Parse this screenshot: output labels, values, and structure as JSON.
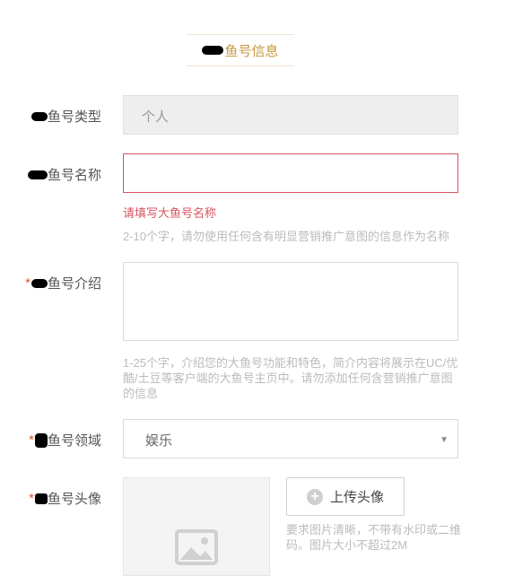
{
  "section": {
    "title": "鱼号信息"
  },
  "form": {
    "type": {
      "label": "鱼号类型",
      "value": "个人"
    },
    "name": {
      "label": "鱼号名称",
      "value": "",
      "error": "请填写大鱼号名称",
      "hint": "2-10个字，请勿使用任何含有明显营销推广意图的信息作为名称"
    },
    "intro": {
      "label": "鱼号介绍",
      "required_mark": "*",
      "value": "",
      "hint": "1-25个字，介绍您的大鱼号功能和特色，简介内容将展示在UC/优酷/土豆等客户端的大鱼号主页中。请勿添加任何含营销推广意图的信息"
    },
    "domain": {
      "label": "鱼号领域",
      "required_mark": "*",
      "value": "娱乐",
      "arrow_icon": "caret-down-icon"
    },
    "avatar": {
      "label": "鱼号头像",
      "required_mark": "*",
      "upload_label": "上传头像",
      "upload_icon": "plus-circle-icon",
      "placeholder_icon": "image-icon",
      "hint": "要求图片清晰，不带有水印或二维码。图片大小不超过2M"
    }
  },
  "colors": {
    "accent": "#c8963e",
    "error": "#d9535f",
    "required": "#e4572e"
  }
}
